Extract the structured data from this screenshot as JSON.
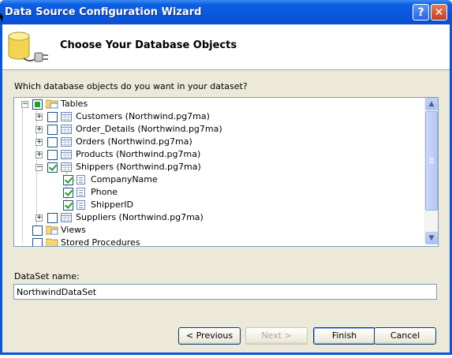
{
  "window": {
    "title": "Data Source Configuration Wizard",
    "help_glyph": "?",
    "close_glyph": "✕"
  },
  "header": {
    "title": "Choose Your Database Objects",
    "icon": "database-plug-icon"
  },
  "question": "Which database objects do you want in your dataset?",
  "tree": {
    "root": {
      "label": "Tables",
      "expander": "−",
      "state": "partial"
    },
    "tables": [
      {
        "label": "Customers (Northwind.pg7ma)",
        "expander": "+",
        "checked": false
      },
      {
        "label": "Order_Details (Northwind.pg7ma)",
        "expander": "+",
        "checked": false
      },
      {
        "label": "Orders (Northwind.pg7ma)",
        "expander": "+",
        "checked": false
      },
      {
        "label": "Products (Northwind.pg7ma)",
        "expander": "+",
        "checked": false
      },
      {
        "label": "Shippers (Northwind.pg7ma)",
        "expander": "−",
        "checked": true
      }
    ],
    "shipper_fields": [
      {
        "label": "CompanyName",
        "checked": true
      },
      {
        "label": "Phone",
        "checked": true
      },
      {
        "label": "ShipperID",
        "checked": true
      }
    ],
    "suppliers": {
      "label": "Suppliers (Northwind.pg7ma)",
      "expander": "+",
      "checked": false
    },
    "views": {
      "label": "Views",
      "checked": false
    },
    "stored_procedures": {
      "label": "Stored Procedures",
      "checked": false
    },
    "scroll_up": "▲",
    "scroll_down": "▼"
  },
  "dataset": {
    "label": "DataSet name:",
    "value": "NorthwindDataSet"
  },
  "buttons": {
    "previous": "< Previous",
    "next": "Next >",
    "finish": "Finish",
    "cancel": "Cancel"
  },
  "colors": {
    "titlebar": "#0a56d8",
    "dialog_bg": "#ece9d8",
    "check_green": "#21a121"
  }
}
